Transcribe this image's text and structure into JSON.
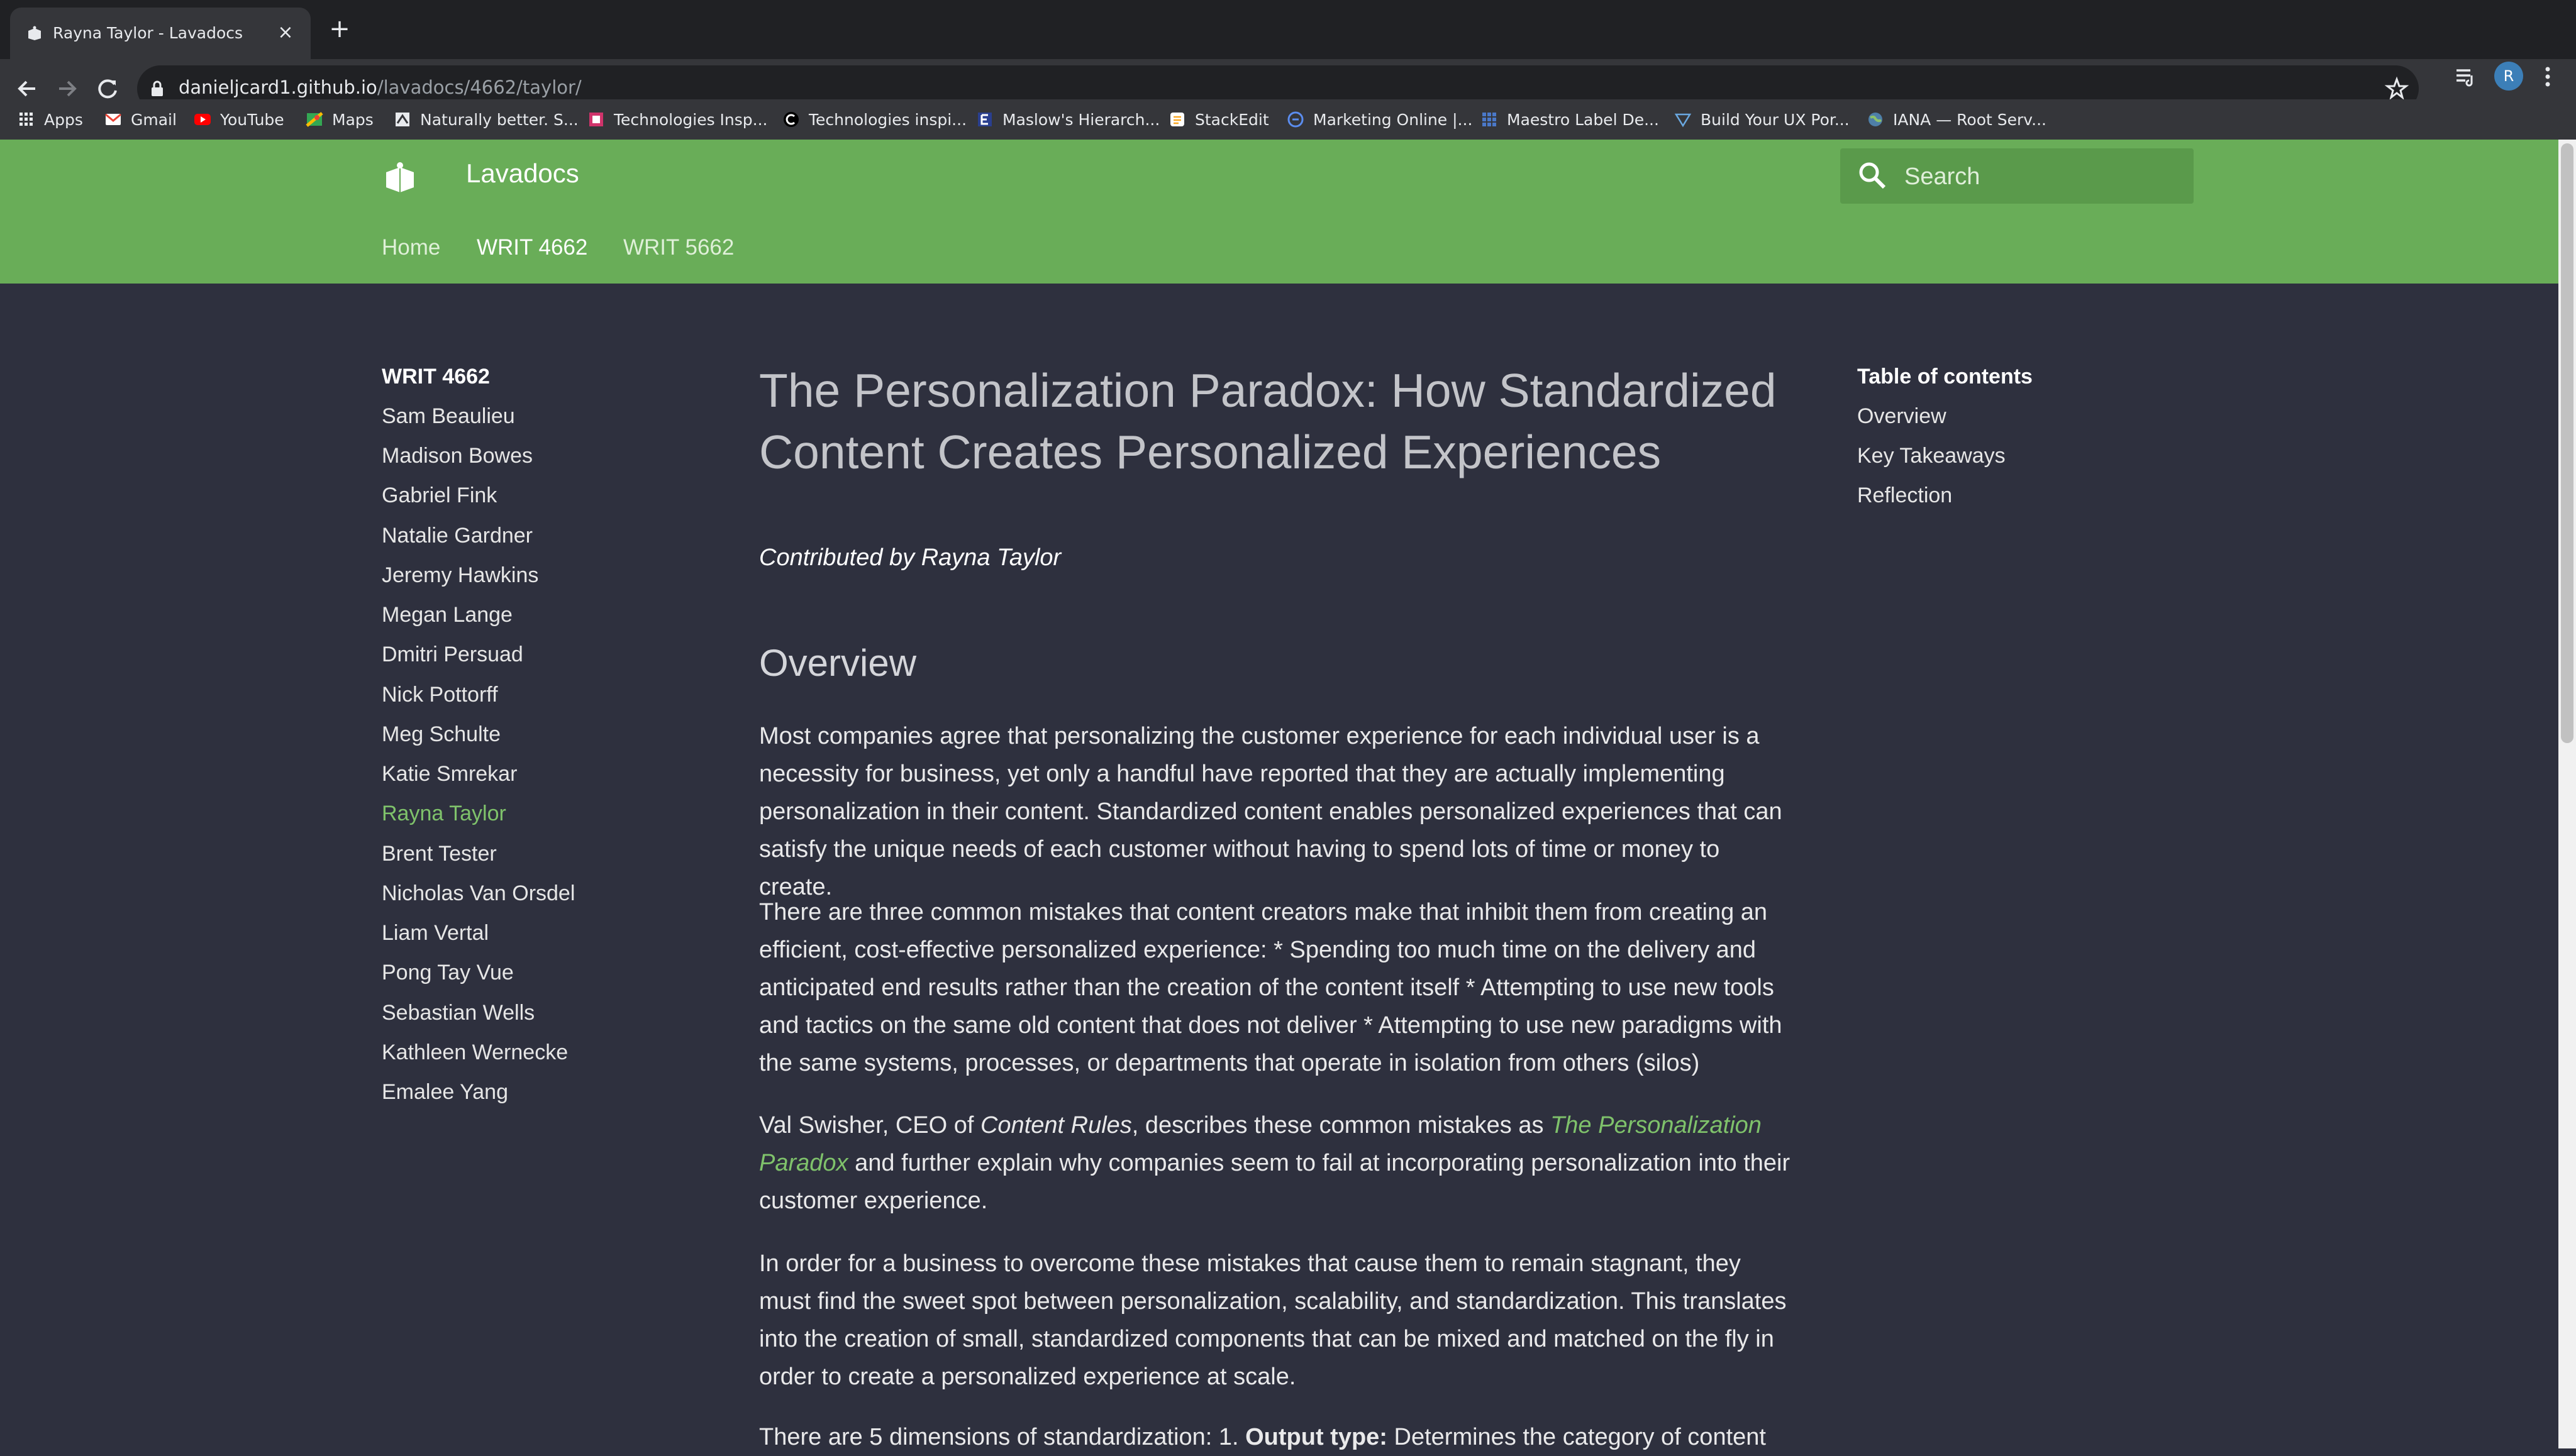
{
  "browser": {
    "tab_title": "Rayna Taylor - Lavadocs",
    "url_host": "danieljcard1.github.io",
    "url_path": "/lavadocs/4662/taylor/",
    "profile_initial": "R",
    "bookmarks": [
      {
        "label": "Apps",
        "icon": "apps-grid-icon"
      },
      {
        "label": "Gmail",
        "icon": "gmail-icon"
      },
      {
        "label": "YouTube",
        "icon": "youtube-icon"
      },
      {
        "label": "Maps",
        "icon": "maps-icon"
      },
      {
        "label": "Naturally better. S...",
        "icon": "bookmark-page-icon"
      },
      {
        "label": "Technologies Insp...",
        "icon": "bookmark-page-icon"
      },
      {
        "label": "Technologies inspi...",
        "icon": "bookmark-page-icon"
      },
      {
        "label": "Maslow's Hierarch...",
        "icon": "bookmark-page-icon"
      },
      {
        "label": "StackEdit",
        "icon": "stackedit-icon"
      },
      {
        "label": "Marketing Online |...",
        "icon": "bookmark-page-icon"
      },
      {
        "label": "Maestro Label De...",
        "icon": "bookmark-page-icon"
      },
      {
        "label": "Build Your UX Por...",
        "icon": "bookmark-page-icon"
      },
      {
        "label": "IANA — Root Serv...",
        "icon": "globe-icon"
      }
    ]
  },
  "site": {
    "title": "Lavadocs",
    "search_placeholder": "Search",
    "brand_color": "#69ad58",
    "link_color": "#7fc26b",
    "nav": [
      "Home",
      "WRIT 4662",
      "WRIT 5662"
    ],
    "nav_active": "WRIT 4662"
  },
  "sidebar": {
    "heading": "WRIT 4662",
    "items": [
      "Sam Beaulieu",
      "Madison Bowes",
      "Gabriel Fink",
      "Natalie Gardner",
      "Jeremy Hawkins",
      "Megan Lange",
      "Dmitri Persuad",
      "Nick Pottorff",
      "Meg Schulte",
      "Katie Smrekar",
      "Rayna Taylor",
      "Brent Tester",
      "Nicholas Van Orsdel",
      "Liam Vertal",
      "Pong Tay Vue",
      "Sebastian Wells",
      "Kathleen Wernecke",
      "Emalee Yang"
    ],
    "active_item": "Rayna Taylor"
  },
  "toc": {
    "heading": "Table of contents",
    "items": [
      "Overview",
      "Key Takeaways",
      "Reflection"
    ]
  },
  "article": {
    "title": "The Personalization Paradox: How Standardized Content Creates Personalized Experiences",
    "byline": "Contributed by Rayna Taylor",
    "overview_heading": "Overview",
    "p1": "Most companies agree that personalizing the customer experience for each individual user is a necessity for business, yet only a handful have reported that they are actually implementing personalization in their content. Standardized content enables personalized experiences that can satisfy the unique needs of each customer without having to spend lots of time or money to create.",
    "p2": "There are three common mistakes that content creators make that inhibit them from creating an efficient, cost-effective personalized experience: * Spending too much time on the delivery and anticipated end results rather than the creation of the content itself * Attempting to use new tools and tactics on the same old content that does not deliver * Attempting to use new paradigms with the same systems, processes, or departments that operate in isolation from others (silos)",
    "p3_a": "Val Swisher, CEO of ",
    "p3_em": "Content Rules",
    "p3_b": ", describes these common mistakes as ",
    "p3_link": "The Personalization Paradox",
    "p3_c": " and further explain why companies seem to fail at incorporating personalization into their customer experience.",
    "p4": "In order for a business to overcome these mistakes that cause them to remain stagnant, they must find the sweet spot between personalization, scalability, and standardization. This translates into the creation of small, standardized components that can be mixed and matched on the fly in order to create a personalized experience at scale.",
    "p5_a": "There are 5 dimensions of standardization: 1. ",
    "p5_b": "Output type:",
    "p5_c": " Determines the category of content"
  }
}
